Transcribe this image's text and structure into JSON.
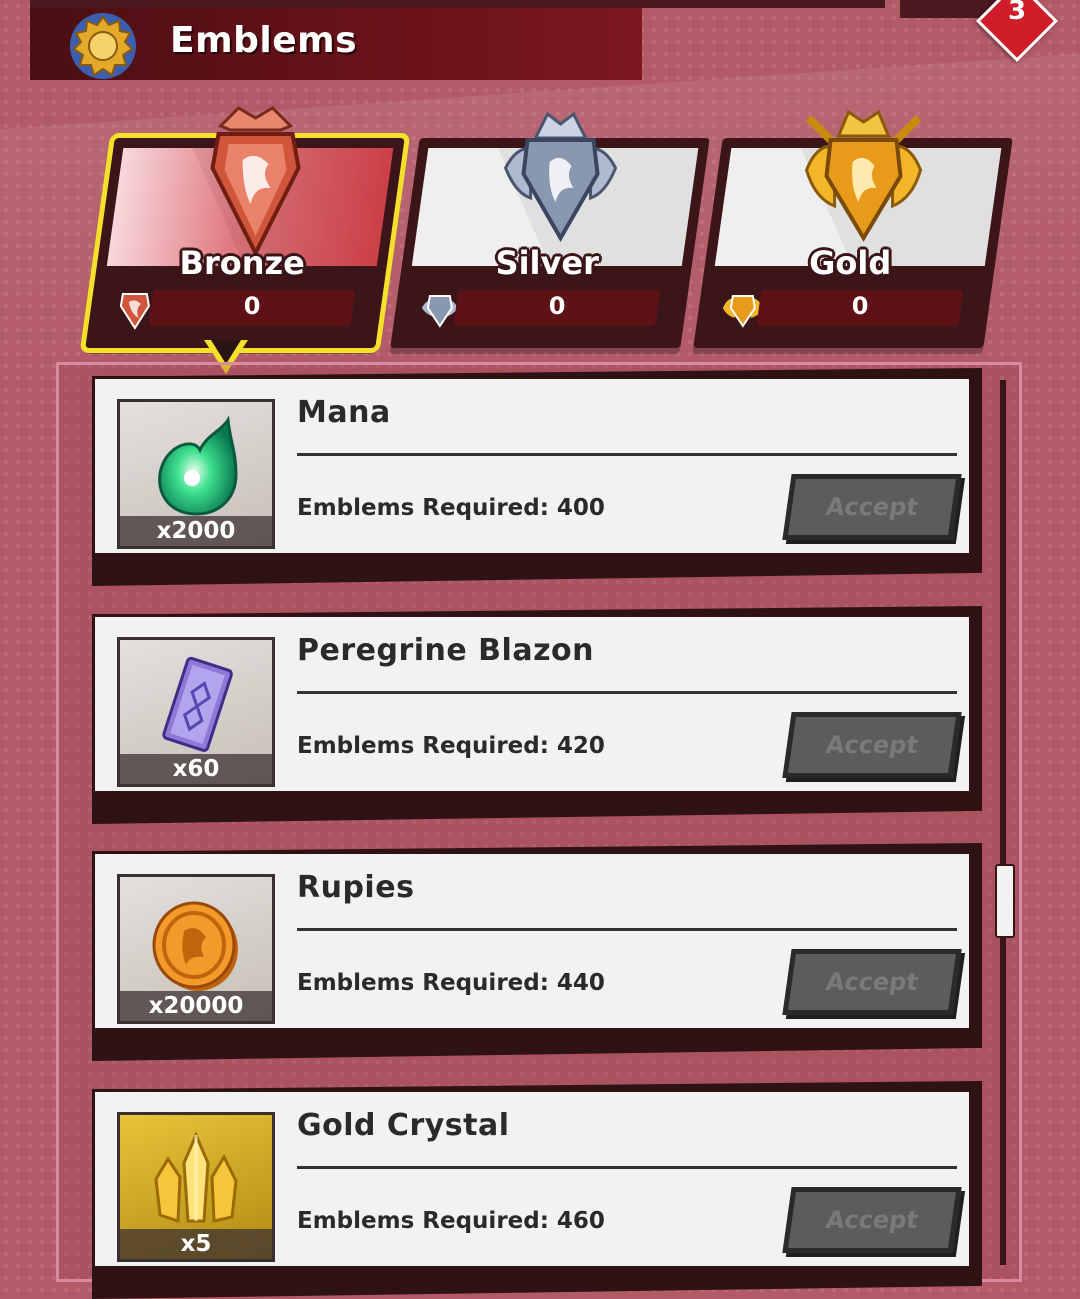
{
  "header": {
    "title": "Emblems",
    "notification_count": "3"
  },
  "tiers": [
    {
      "label": "Bronze",
      "count": "0",
      "active": true
    },
    {
      "label": "Silver",
      "count": "0",
      "active": false
    },
    {
      "label": "Gold",
      "count": "0",
      "active": false
    }
  ],
  "rewards": [
    {
      "name": "Mana",
      "quantity": "x2000",
      "requirement": "Emblems Required: 400",
      "button": "Accept",
      "icon": "mana-orb-icon"
    },
    {
      "name": "Peregrine Blazon",
      "quantity": "x60",
      "requirement": "Emblems Required: 420",
      "button": "Accept",
      "icon": "blazon-card-icon"
    },
    {
      "name": "Rupies",
      "quantity": "x20000",
      "requirement": "Emblems Required: 440",
      "button": "Accept",
      "icon": "rupie-coin-icon"
    },
    {
      "name": "Gold Crystal",
      "quantity": "x5",
      "requirement": "Emblems Required: 460",
      "button": "Accept",
      "icon": "gold-crystal-icon"
    }
  ],
  "colors": {
    "background": "#b25a68",
    "active_outline": "#f5e12a",
    "header_bar": "#6a1219",
    "badge": "#d01d2a"
  }
}
